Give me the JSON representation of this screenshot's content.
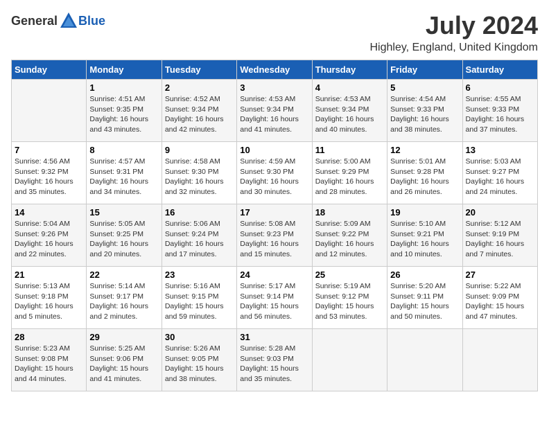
{
  "header": {
    "logo_general": "General",
    "logo_blue": "Blue",
    "title": "July 2024",
    "location": "Highley, England, United Kingdom"
  },
  "days_of_week": [
    "Sunday",
    "Monday",
    "Tuesday",
    "Wednesday",
    "Thursday",
    "Friday",
    "Saturday"
  ],
  "weeks": [
    [
      {
        "day": "",
        "info": ""
      },
      {
        "day": "1",
        "info": "Sunrise: 4:51 AM\nSunset: 9:35 PM\nDaylight: 16 hours\nand 43 minutes."
      },
      {
        "day": "2",
        "info": "Sunrise: 4:52 AM\nSunset: 9:34 PM\nDaylight: 16 hours\nand 42 minutes."
      },
      {
        "day": "3",
        "info": "Sunrise: 4:53 AM\nSunset: 9:34 PM\nDaylight: 16 hours\nand 41 minutes."
      },
      {
        "day": "4",
        "info": "Sunrise: 4:53 AM\nSunset: 9:34 PM\nDaylight: 16 hours\nand 40 minutes."
      },
      {
        "day": "5",
        "info": "Sunrise: 4:54 AM\nSunset: 9:33 PM\nDaylight: 16 hours\nand 38 minutes."
      },
      {
        "day": "6",
        "info": "Sunrise: 4:55 AM\nSunset: 9:33 PM\nDaylight: 16 hours\nand 37 minutes."
      }
    ],
    [
      {
        "day": "7",
        "info": "Sunrise: 4:56 AM\nSunset: 9:32 PM\nDaylight: 16 hours\nand 35 minutes."
      },
      {
        "day": "8",
        "info": "Sunrise: 4:57 AM\nSunset: 9:31 PM\nDaylight: 16 hours\nand 34 minutes."
      },
      {
        "day": "9",
        "info": "Sunrise: 4:58 AM\nSunset: 9:30 PM\nDaylight: 16 hours\nand 32 minutes."
      },
      {
        "day": "10",
        "info": "Sunrise: 4:59 AM\nSunset: 9:30 PM\nDaylight: 16 hours\nand 30 minutes."
      },
      {
        "day": "11",
        "info": "Sunrise: 5:00 AM\nSunset: 9:29 PM\nDaylight: 16 hours\nand 28 minutes."
      },
      {
        "day": "12",
        "info": "Sunrise: 5:01 AM\nSunset: 9:28 PM\nDaylight: 16 hours\nand 26 minutes."
      },
      {
        "day": "13",
        "info": "Sunrise: 5:03 AM\nSunset: 9:27 PM\nDaylight: 16 hours\nand 24 minutes."
      }
    ],
    [
      {
        "day": "14",
        "info": "Sunrise: 5:04 AM\nSunset: 9:26 PM\nDaylight: 16 hours\nand 22 minutes."
      },
      {
        "day": "15",
        "info": "Sunrise: 5:05 AM\nSunset: 9:25 PM\nDaylight: 16 hours\nand 20 minutes."
      },
      {
        "day": "16",
        "info": "Sunrise: 5:06 AM\nSunset: 9:24 PM\nDaylight: 16 hours\nand 17 minutes."
      },
      {
        "day": "17",
        "info": "Sunrise: 5:08 AM\nSunset: 9:23 PM\nDaylight: 16 hours\nand 15 minutes."
      },
      {
        "day": "18",
        "info": "Sunrise: 5:09 AM\nSunset: 9:22 PM\nDaylight: 16 hours\nand 12 minutes."
      },
      {
        "day": "19",
        "info": "Sunrise: 5:10 AM\nSunset: 9:21 PM\nDaylight: 16 hours\nand 10 minutes."
      },
      {
        "day": "20",
        "info": "Sunrise: 5:12 AM\nSunset: 9:19 PM\nDaylight: 16 hours\nand 7 minutes."
      }
    ],
    [
      {
        "day": "21",
        "info": "Sunrise: 5:13 AM\nSunset: 9:18 PM\nDaylight: 16 hours\nand 5 minutes."
      },
      {
        "day": "22",
        "info": "Sunrise: 5:14 AM\nSunset: 9:17 PM\nDaylight: 16 hours\nand 2 minutes."
      },
      {
        "day": "23",
        "info": "Sunrise: 5:16 AM\nSunset: 9:15 PM\nDaylight: 15 hours\nand 59 minutes."
      },
      {
        "day": "24",
        "info": "Sunrise: 5:17 AM\nSunset: 9:14 PM\nDaylight: 15 hours\nand 56 minutes."
      },
      {
        "day": "25",
        "info": "Sunrise: 5:19 AM\nSunset: 9:12 PM\nDaylight: 15 hours\nand 53 minutes."
      },
      {
        "day": "26",
        "info": "Sunrise: 5:20 AM\nSunset: 9:11 PM\nDaylight: 15 hours\nand 50 minutes."
      },
      {
        "day": "27",
        "info": "Sunrise: 5:22 AM\nSunset: 9:09 PM\nDaylight: 15 hours\nand 47 minutes."
      }
    ],
    [
      {
        "day": "28",
        "info": "Sunrise: 5:23 AM\nSunset: 9:08 PM\nDaylight: 15 hours\nand 44 minutes."
      },
      {
        "day": "29",
        "info": "Sunrise: 5:25 AM\nSunset: 9:06 PM\nDaylight: 15 hours\nand 41 minutes."
      },
      {
        "day": "30",
        "info": "Sunrise: 5:26 AM\nSunset: 9:05 PM\nDaylight: 15 hours\nand 38 minutes."
      },
      {
        "day": "31",
        "info": "Sunrise: 5:28 AM\nSunset: 9:03 PM\nDaylight: 15 hours\nand 35 minutes."
      },
      {
        "day": "",
        "info": ""
      },
      {
        "day": "",
        "info": ""
      },
      {
        "day": "",
        "info": ""
      }
    ]
  ]
}
